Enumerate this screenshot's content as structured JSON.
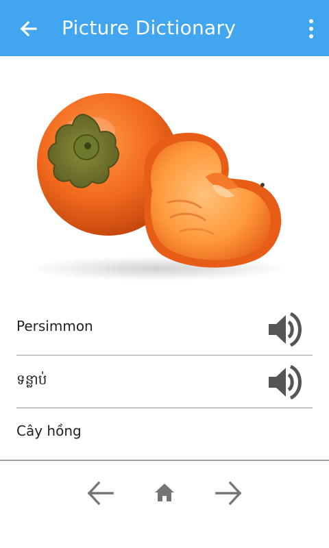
{
  "app_bar": {
    "title": "Picture Dictionary",
    "back_icon": "arrow-back-icon",
    "menu_icon": "more-vert-icon",
    "color": "#42a5f0"
  },
  "entry": {
    "image": "persimmon-photo",
    "english": "Persimmon",
    "khmer": "ទន្លាប់",
    "vietnamese": "Cây hồng"
  },
  "audio": {
    "icon": "volume-up-icon"
  },
  "bottom_nav": {
    "prev_icon": "arrow-back-icon",
    "home_icon": "home-icon",
    "next_icon": "arrow-forward-icon"
  }
}
